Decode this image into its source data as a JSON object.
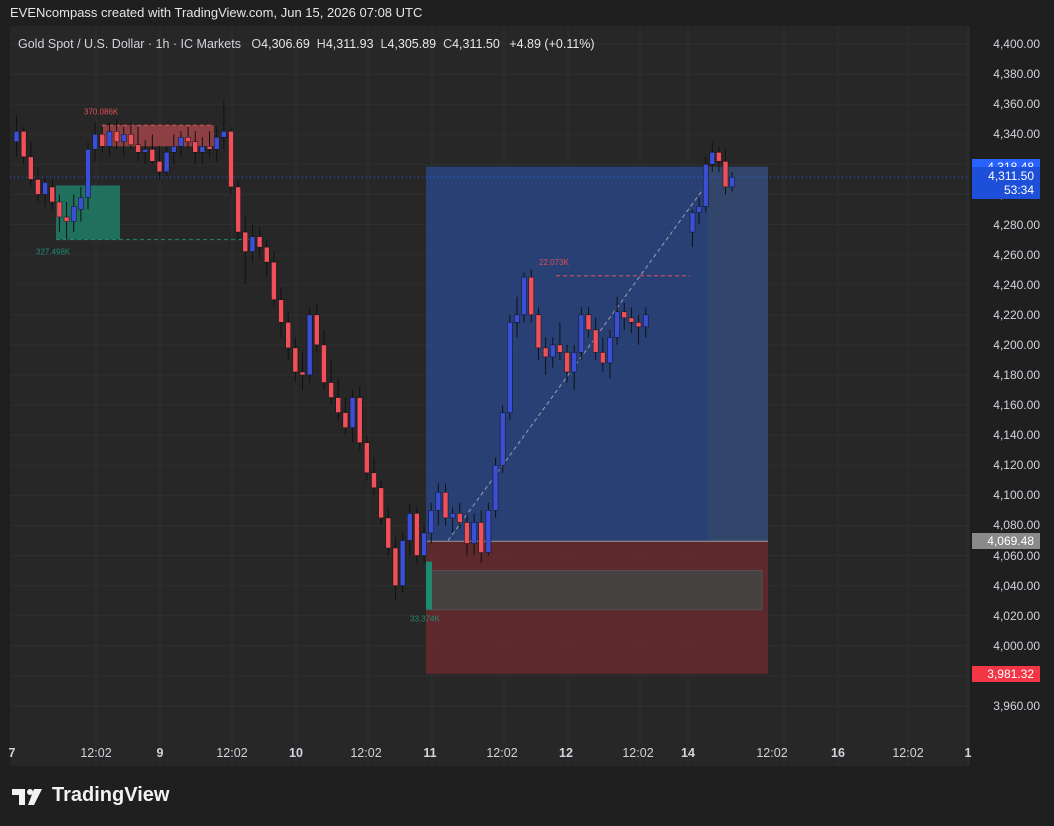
{
  "header": {
    "attribution": "EVENcompass created with TradingView.com, Jun 15, 2026 07:08 UTC"
  },
  "legend": {
    "symbol": "Gold Spot / U.S. Dollar · 1h · IC Markets",
    "o_label": "O",
    "o_value": "4,306.69",
    "h_label": "H",
    "h_value": "4,311.93",
    "l_label": "L",
    "l_value": "4,305.89",
    "c_label": "C",
    "c_value": "4,311.50",
    "change": "+4.89 (+0.11%)"
  },
  "price_axis": {
    "ticks": [
      "4,400.00",
      "4,380.00",
      "4,360.00",
      "4,340.00",
      "4,320.00",
      "4,300.00",
      "4,280.00",
      "4,260.00",
      "4,240.00",
      "4,220.00",
      "4,200.00",
      "4,180.00",
      "4,160.00",
      "4,140.00",
      "4,120.00",
      "4,100.00",
      "4,080.00",
      "4,060.00",
      "4,040.00",
      "4,020.00",
      "4,000.00",
      "3,980.00",
      "3,960.00"
    ],
    "tick_values": [
      4400,
      4380,
      4360,
      4340,
      4320,
      4300,
      4280,
      4260,
      4240,
      4220,
      4200,
      4180,
      4160,
      4140,
      4120,
      4100,
      4080,
      4060,
      4040,
      4020,
      4000,
      3980,
      3960
    ],
    "min": 3945,
    "max": 4415,
    "target_tag": "4,318.48",
    "current_tag": "4,311.50",
    "countdown": "53:34",
    "entry_tag": "4,069.48",
    "stop_tag": "3,981.32"
  },
  "time_axis": {
    "labels": [
      "7",
      "12:02",
      "9",
      "12:02",
      "10",
      "12:02",
      "11",
      "12:02",
      "12",
      "12:02",
      "14",
      "12:02",
      "16",
      "12:02",
      "1"
    ],
    "bold": [
      true,
      false,
      true,
      false,
      true,
      false,
      true,
      false,
      true,
      false,
      true,
      false,
      true,
      false,
      true
    ]
  },
  "annotations": {
    "vol_red_top": "370.086K",
    "vol_green_left": "327.498K",
    "vol_red_mid": "22.073K",
    "vol_green_low": "33.374K"
  },
  "colors": {
    "up": "#3a4fd6",
    "down": "#f0505a",
    "position_profit": "#2a4a8f",
    "position_loss": "#6b2a2f",
    "current_tag": "#2962ff",
    "entry_tag": "#8a8a8a",
    "stop_tag": "#f23645"
  },
  "logo": {
    "text": "TradingView",
    "icon": "tradingview-logo-icon"
  },
  "chart_data": {
    "type": "candlestick",
    "title": "Gold Spot / U.S. Dollar · 1h · IC Markets",
    "ylim": [
      3945,
      4415
    ],
    "candles": [
      [
        4335,
        4352,
        4325,
        4342
      ],
      [
        4342,
        4345,
        4320,
        4325
      ],
      [
        4325,
        4335,
        4305,
        4310
      ],
      [
        4310,
        4318,
        4295,
        4300
      ],
      [
        4300,
        4312,
        4292,
        4308
      ],
      [
        4305,
        4310,
        4290,
        4295
      ],
      [
        4295,
        4300,
        4275,
        4285
      ],
      [
        4285,
        4295,
        4270,
        4282
      ],
      [
        4282,
        4300,
        4275,
        4292
      ],
      [
        4290,
        4305,
        4282,
        4298
      ],
      [
        4298,
        4335,
        4290,
        4330
      ],
      [
        4330,
        4348,
        4322,
        4340
      ],
      [
        4340,
        4345,
        4328,
        4332
      ],
      [
        4332,
        4348,
        4325,
        4342
      ],
      [
        4342,
        4350,
        4330,
        4335
      ],
      [
        4335,
        4345,
        4325,
        4340
      ],
      [
        4340,
        4348,
        4330,
        4333
      ],
      [
        4333,
        4345,
        4322,
        4328
      ],
      [
        4328,
        4336,
        4320,
        4330
      ],
      [
        4330,
        4340,
        4320,
        4322
      ],
      [
        4322,
        4332,
        4310,
        4315
      ],
      [
        4315,
        4332,
        4312,
        4328
      ],
      [
        4328,
        4340,
        4320,
        4332
      ],
      [
        4332,
        4342,
        4325,
        4338
      ],
      [
        4338,
        4345,
        4330,
        4335
      ],
      [
        4335,
        4342,
        4320,
        4328
      ],
      [
        4328,
        4338,
        4320,
        4332
      ],
      [
        4332,
        4342,
        4325,
        4330
      ],
      [
        4330,
        4345,
        4322,
        4338
      ],
      [
        4338,
        4362,
        4330,
        4342
      ],
      [
        4342,
        4345,
        4300,
        4305
      ],
      [
        4305,
        4310,
        4270,
        4275
      ],
      [
        4275,
        4285,
        4240,
        4262
      ],
      [
        4262,
        4280,
        4255,
        4272
      ],
      [
        4272,
        4278,
        4258,
        4265
      ],
      [
        4265,
        4270,
        4245,
        4255
      ],
      [
        4255,
        4262,
        4225,
        4230
      ],
      [
        4230,
        4238,
        4205,
        4215
      ],
      [
        4215,
        4222,
        4190,
        4198
      ],
      [
        4198,
        4205,
        4175,
        4182
      ],
      [
        4182,
        4195,
        4170,
        4180
      ],
      [
        4180,
        4225,
        4175,
        4220
      ],
      [
        4220,
        4228,
        4195,
        4200
      ],
      [
        4200,
        4210,
        4170,
        4175
      ],
      [
        4175,
        4190,
        4160,
        4165
      ],
      [
        4165,
        4178,
        4150,
        4155
      ],
      [
        4155,
        4165,
        4140,
        4145
      ],
      [
        4145,
        4170,
        4135,
        4165
      ],
      [
        4165,
        4172,
        4130,
        4135
      ],
      [
        4135,
        4140,
        4110,
        4115
      ],
      [
        4115,
        4125,
        4100,
        4105
      ],
      [
        4105,
        4110,
        4080,
        4085
      ],
      [
        4085,
        4092,
        4060,
        4065
      ],
      [
        4065,
        4072,
        4030,
        4040
      ],
      [
        4040,
        4075,
        4035,
        4070
      ],
      [
        4070,
        4095,
        4060,
        4088
      ],
      [
        4088,
        4092,
        4055,
        4060
      ],
      [
        4060,
        4080,
        4055,
        4075
      ],
      [
        4075,
        4095,
        4068,
        4090
      ],
      [
        4090,
        4108,
        4080,
        4102
      ],
      [
        4102,
        4108,
        4080,
        4085
      ],
      [
        4085,
        4092,
        4075,
        4088
      ],
      [
        4088,
        4095,
        4078,
        4082
      ],
      [
        4082,
        4088,
        4060,
        4068
      ],
      [
        4068,
        4088,
        4060,
        4082
      ],
      [
        4082,
        4090,
        4055,
        4062
      ],
      [
        4062,
        4095,
        4060,
        4090
      ],
      [
        4090,
        4125,
        4085,
        4120
      ],
      [
        4120,
        4160,
        4115,
        4155
      ],
      [
        4155,
        4220,
        4150,
        4215
      ],
      [
        4215,
        4232,
        4205,
        4220
      ],
      [
        4220,
        4248,
        4215,
        4245
      ],
      [
        4245,
        4250,
        4215,
        4220
      ],
      [
        4220,
        4225,
        4190,
        4198
      ],
      [
        4198,
        4205,
        4180,
        4192
      ],
      [
        4192,
        4205,
        4185,
        4200
      ],
      [
        4200,
        4215,
        4190,
        4195
      ],
      [
        4195,
        4200,
        4175,
        4182
      ],
      [
        4182,
        4200,
        4170,
        4195
      ],
      [
        4195,
        4225,
        4190,
        4220
      ],
      [
        4220,
        4225,
        4205,
        4210
      ],
      [
        4210,
        4218,
        4190,
        4195
      ],
      [
        4195,
        4205,
        4182,
        4188
      ],
      [
        4188,
        4210,
        4178,
        4205
      ],
      [
        4205,
        4232,
        4200,
        4222
      ],
      [
        4222,
        4228,
        4210,
        4218
      ],
      [
        4218,
        4225,
        4208,
        4215
      ],
      [
        4215,
        4220,
        4200,
        4212
      ],
      [
        4212,
        4225,
        4205,
        4220
      ],
      [
        4275,
        4290,
        4265,
        4288
      ],
      [
        4288,
        4298,
        4280,
        4292
      ],
      [
        4292,
        4325,
        4288,
        4320
      ],
      [
        4320,
        4335,
        4315,
        4328
      ],
      [
        4328,
        4332,
        4315,
        4322
      ],
      [
        4322,
        4330,
        4300,
        4305
      ],
      [
        4305,
        4315,
        4302,
        4311.5
      ]
    ]
  }
}
